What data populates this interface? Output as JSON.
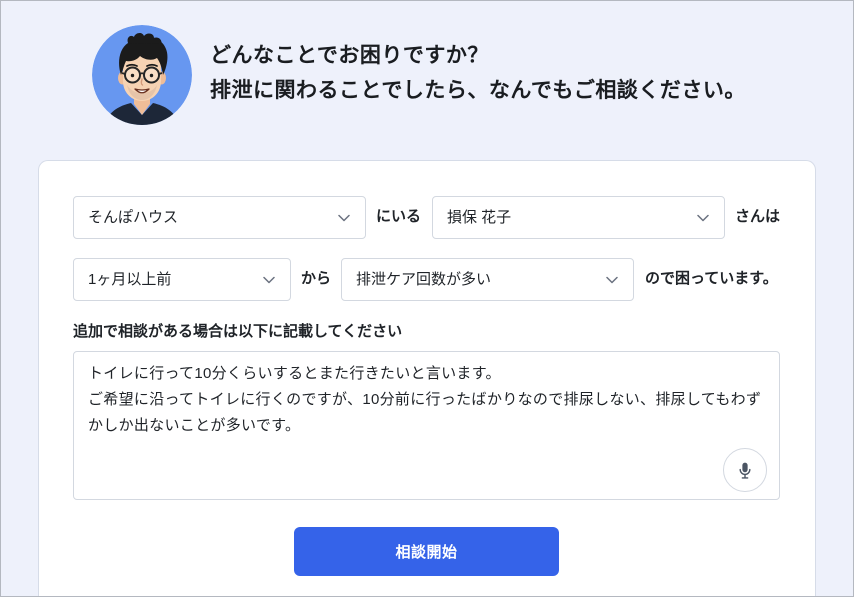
{
  "colors": {
    "page_background": "#eef1fb",
    "accent": "#3563e9",
    "avatar_background": "#6797f0"
  },
  "header": {
    "avatar_icon": "person-with-glasses-avatar",
    "line1": "どんなことでお困りですか？",
    "line2": "排泄に関わることでしたら、なんでもご相談ください。"
  },
  "form": {
    "facility_select": {
      "value": "そんぽハウス",
      "icon": "chevron-down-icon"
    },
    "text_after_facility": "にいる",
    "resident_select": {
      "value": "損保 花子",
      "icon": "chevron-down-icon"
    },
    "text_after_resident": "さんは",
    "period_select": {
      "value": "1ヶ月以上前",
      "icon": "chevron-down-icon"
    },
    "text_after_period": "から",
    "concern_select": {
      "value": "排泄ケア回数が多い",
      "icon": "chevron-down-icon"
    },
    "text_after_concern": "ので困っています。",
    "notes_label": "追加で相談がある場合は以下に記載してください",
    "notes_value": "トイレに行って10分くらいするとまた行きたいと言います。\nご希望に沿ってトイレに行くのですが、10分前に行ったばかりなので排尿しない、排尿してもわずかしか出ないことが多いです。",
    "voice_input_icon": "microphone-icon",
    "submit_label": "相談開始"
  }
}
